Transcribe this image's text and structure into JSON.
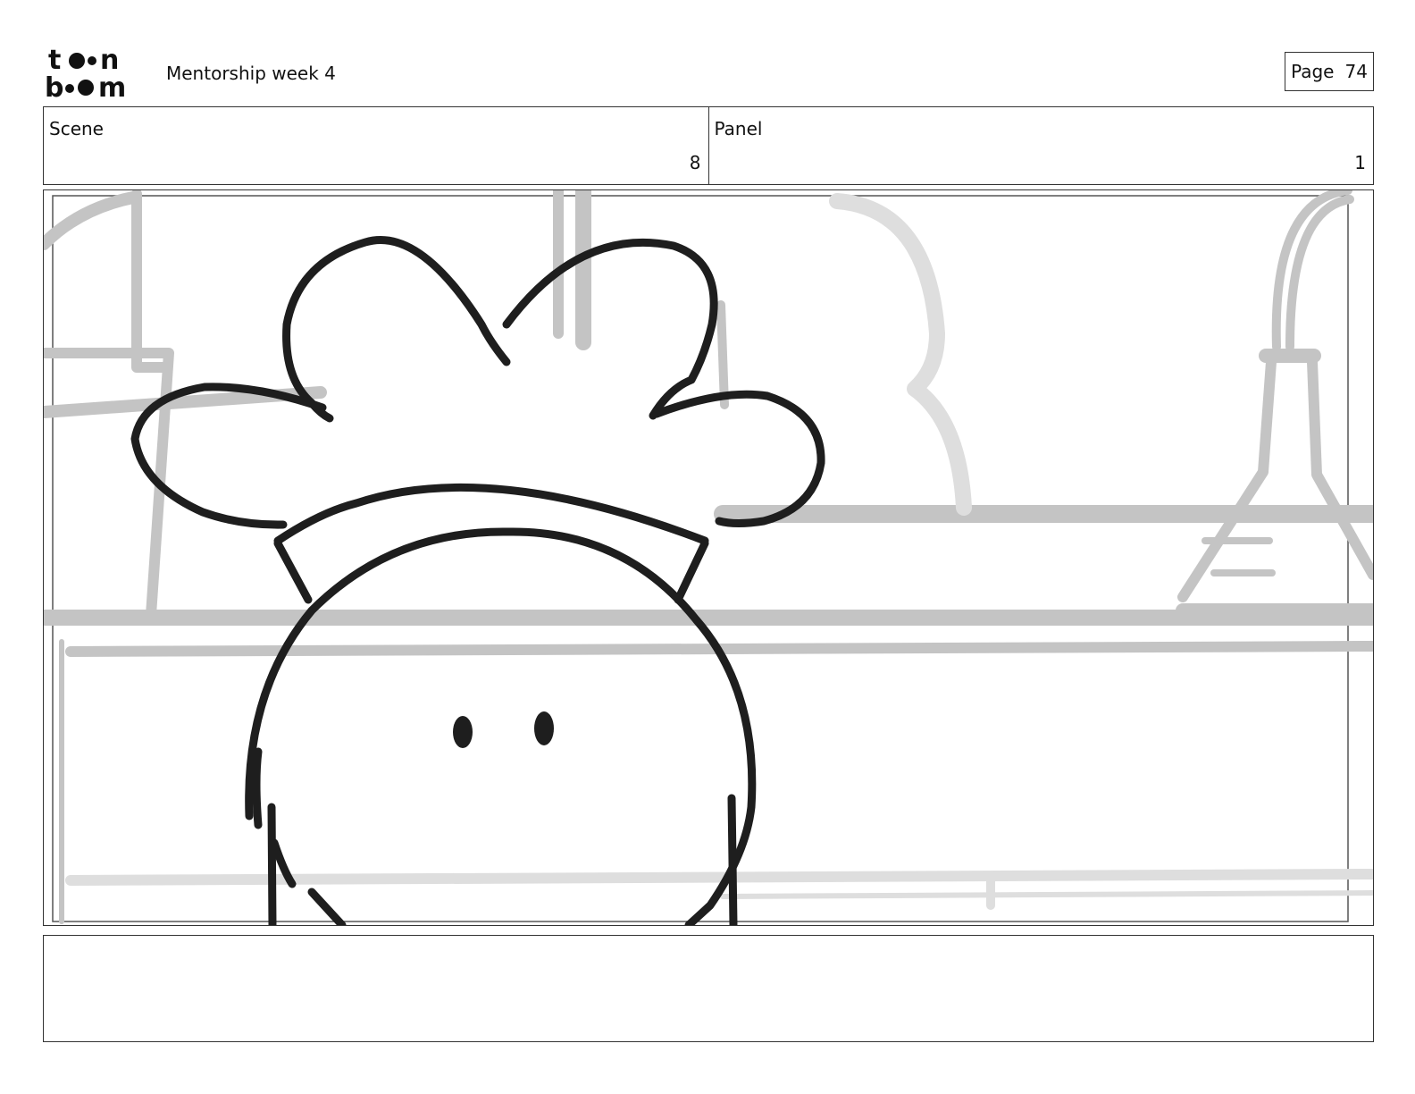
{
  "header": {
    "logo_text": "toon boom",
    "project_title": "Mentorship week 4",
    "page_label": "Page",
    "page_number": "74"
  },
  "info": {
    "scene_label": "Scene",
    "scene_value": "8",
    "panel_label": "Panel",
    "panel_value": "1"
  },
  "drawing": {
    "subject": "chef-character-sketch",
    "background": "kitchen-shelves-with-flask",
    "ink_color": "#1e1e1e",
    "background_line_color": "#c4c4c4"
  },
  "notes": {
    "text": ""
  }
}
